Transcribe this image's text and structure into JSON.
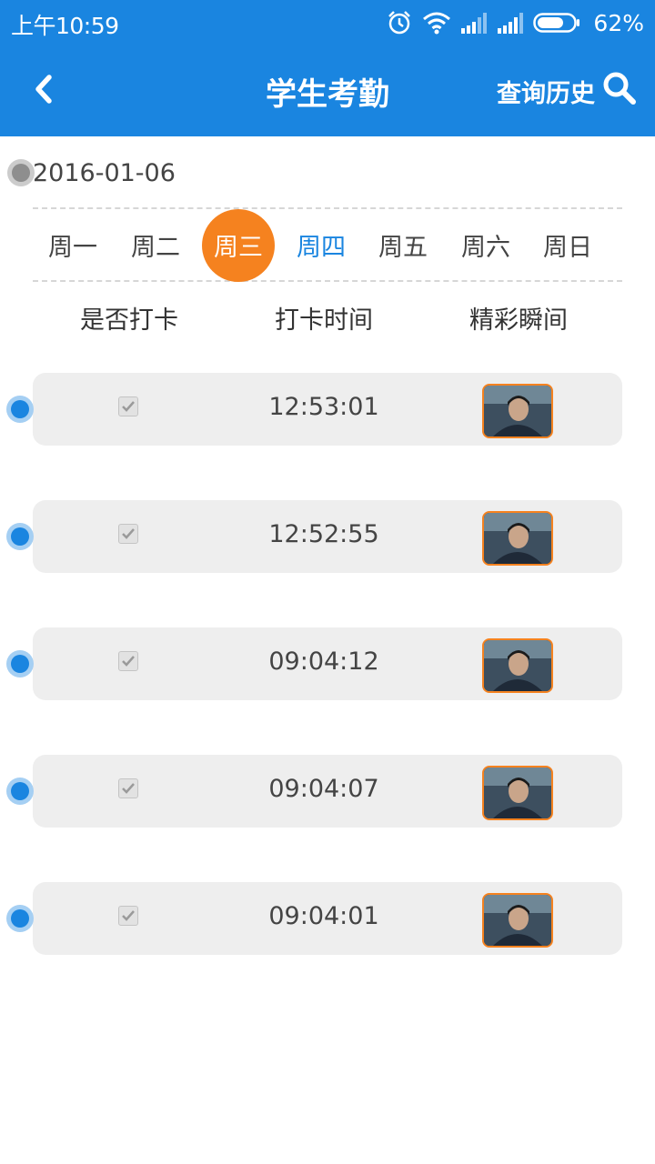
{
  "status_bar": {
    "time": "上午10:59",
    "battery": "62%",
    "battery_level": 0.62,
    "icons": [
      "alarm-icon",
      "wifi-icon",
      "signal-icon",
      "signal-icon",
      "battery-icon"
    ]
  },
  "header": {
    "back_icon": "chevron-left-icon",
    "title": "学生考勤",
    "history_label": "查询历史",
    "search_icon": "search-icon"
  },
  "date": "2016-01-06",
  "week": {
    "days": [
      "周一",
      "周二",
      "周三",
      "周四",
      "周五",
      "周六",
      "周日"
    ],
    "selected_index": 2,
    "today_index": 3
  },
  "columns": {
    "checked": "是否打卡",
    "time": "打卡时间",
    "moment": "精彩瞬间"
  },
  "records": [
    {
      "checked": true,
      "time": "12:53:01",
      "photo": "student-photo"
    },
    {
      "checked": true,
      "time": "12:52:55",
      "photo": "student-photo"
    },
    {
      "checked": true,
      "time": "09:04:12",
      "photo": "student-photo"
    },
    {
      "checked": true,
      "time": "09:04:07",
      "photo": "student-photo"
    },
    {
      "checked": true,
      "time": "09:04:01",
      "photo": "student-photo"
    }
  ],
  "colors": {
    "primary": "#1a85e0",
    "accent": "#f5821f",
    "row_background": "#eeeeee"
  }
}
